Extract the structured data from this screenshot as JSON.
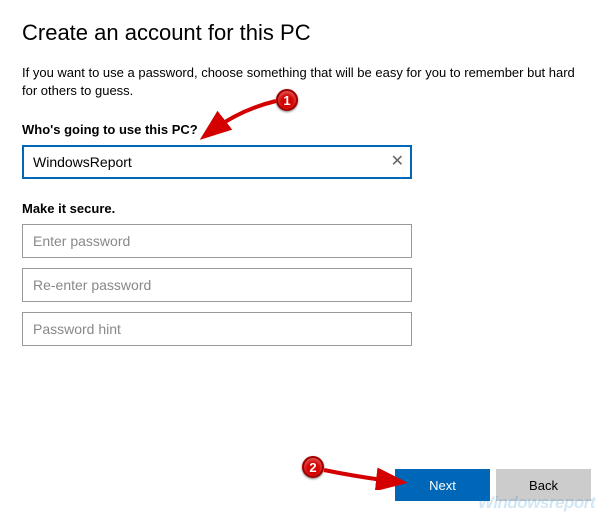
{
  "title": "Create an account for this PC",
  "subtitle": "If you want to use a password, choose something that will be easy for you to remember but hard for others to guess.",
  "section_user_label": "Who's going to use this PC?",
  "username_value": "WindowsReport",
  "section_secure_label": "Make it secure.",
  "password_placeholder": "Enter password",
  "password_confirm_placeholder": "Re-enter password",
  "password_hint_placeholder": "Password hint",
  "next_label": "Next",
  "back_label": "Back",
  "watermark": "Windowsreport",
  "annotation_1": "1",
  "annotation_2": "2"
}
